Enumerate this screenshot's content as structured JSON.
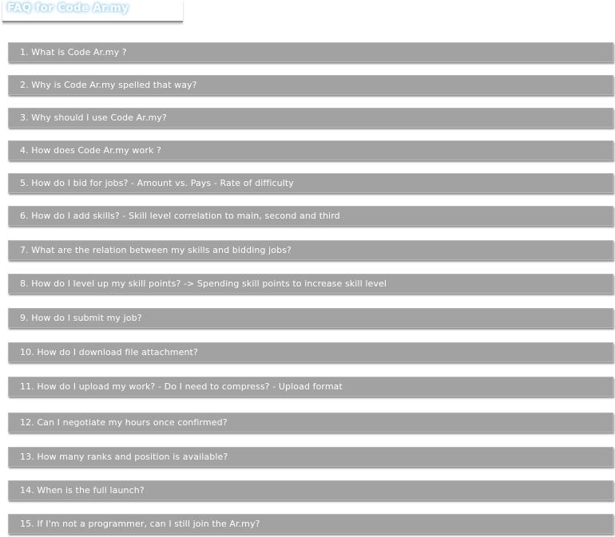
{
  "page": {
    "title": "FAQ for Code Ar.my"
  },
  "faq": {
    "items": [
      {
        "label": "1. What is Code Ar.my ?"
      },
      {
        "label": "2. Why is Code Ar.my spelled that way?"
      },
      {
        "label": "3. Why should I use Code Ar.my?"
      },
      {
        "label": "4. How does Code Ar.my work ?"
      },
      {
        "label": "5. How do I bid for jobs? - Amount vs. Pays - Rate of difficulty"
      },
      {
        "label": "6. How do I add skills? - Skill level correlation to main, second and third"
      },
      {
        "label": "7. What are the relation between my skills and bidding jobs?"
      },
      {
        "label": "8. How do I level up my skill points? -> Spending skill points to increase skill level"
      },
      {
        "label": "9. How do I submit my job?"
      },
      {
        "label": "10. How do I download file attachment?"
      },
      {
        "label": "11. How do I upload my work? - Do I need to compress? - Upload format"
      },
      {
        "label": "12. Can I negotiate my hours once confirmed?"
      },
      {
        "label": "13. How many ranks and position is available?"
      },
      {
        "label": "14. When is the full launch?"
      },
      {
        "label": "15. If I'm not a programmer, can I still join the Ar.my?"
      }
    ]
  }
}
